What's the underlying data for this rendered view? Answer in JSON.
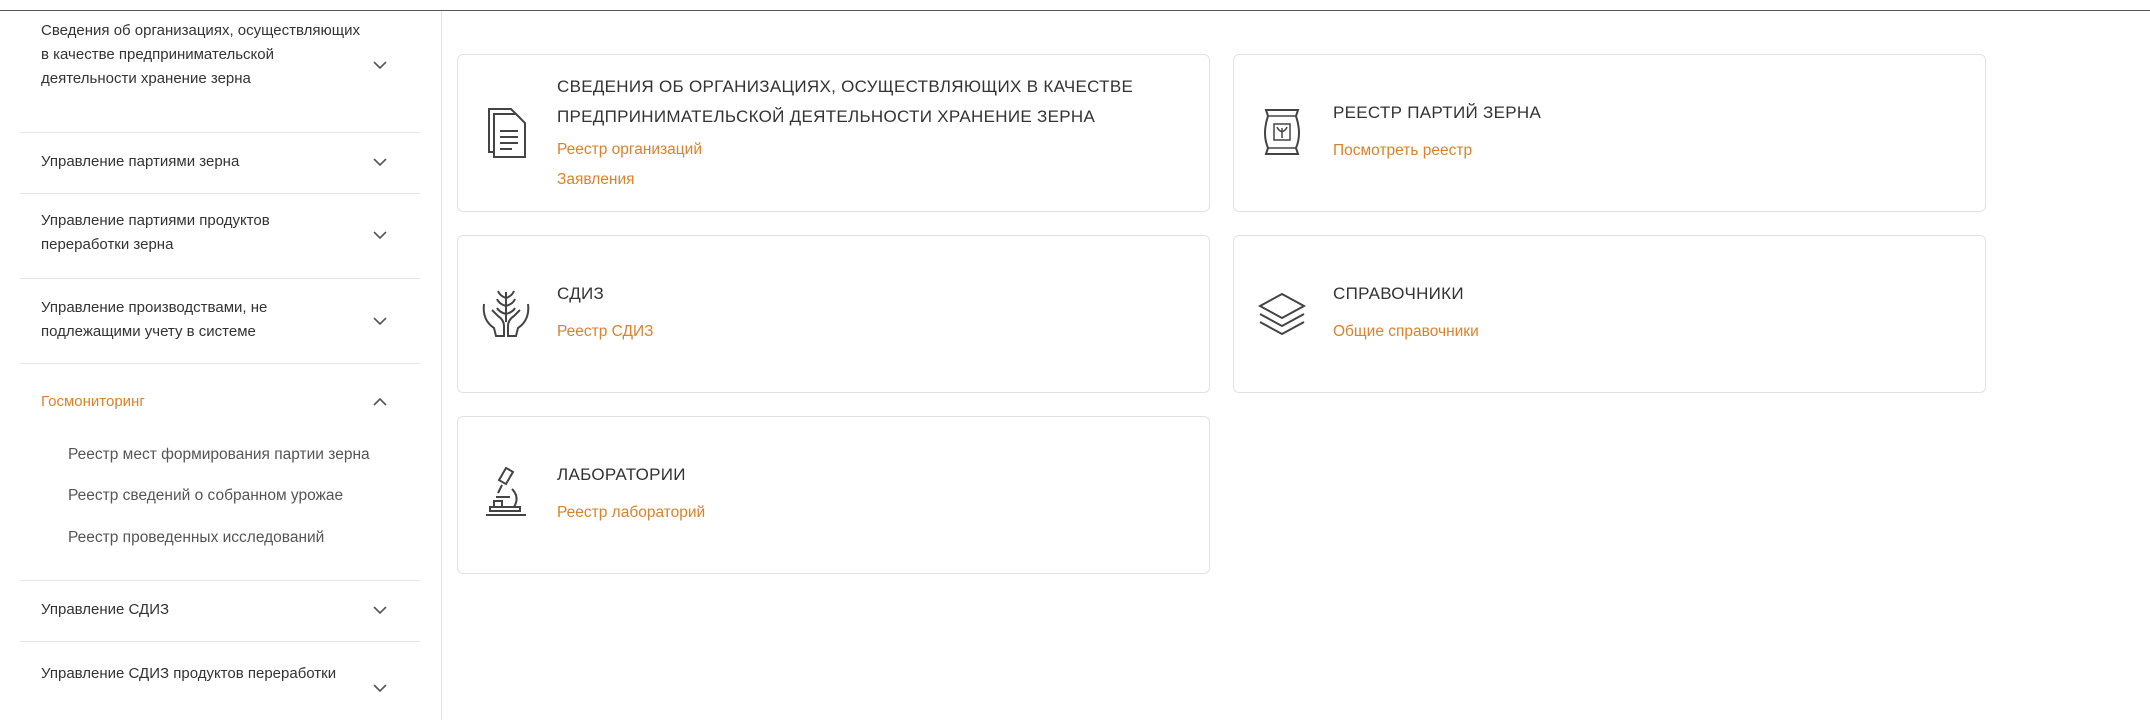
{
  "sidebar": {
    "items": [
      {
        "label": "Сведения об организациях, осуществляющих в качестве предпринимательской деятельности хранение зерна",
        "expanded": false
      },
      {
        "label": "Управление партиями зерна",
        "expanded": false
      },
      {
        "label": "Управление партиями продуктов переработки зерна",
        "expanded": false
      },
      {
        "label": "Управление производствами, не подлежащими учету в системе",
        "expanded": false
      },
      {
        "label": "Госмониторинг",
        "expanded": true,
        "children": [
          "Реестр мест формирования партии зерна",
          "Реестр сведений о собранном урожае",
          "Реестр проведенных исследований"
        ]
      },
      {
        "label": "Управление СДИЗ",
        "expanded": false
      },
      {
        "label": "Управление СДИЗ продуктов переработки",
        "expanded": false
      }
    ]
  },
  "cards": [
    {
      "icon": "documents-icon",
      "title": "СВЕДЕНИЯ ОБ ОРГАНИЗАЦИЯХ, ОСУЩЕСТВЛЯЮЩИХ В КАЧЕСТВЕ ПРЕДПРИНИМАТЕЛЬСКОЙ ДЕЯТЕЛЬНОСТИ ХРАНЕНИЕ ЗЕРНА",
      "links": [
        "Реестр организаций",
        "Заявления"
      ]
    },
    {
      "icon": "grain-bag-icon",
      "title": "РЕЕСТР ПАРТИЙ ЗЕРНА",
      "links": [
        "Посмотреть реестр"
      ]
    },
    {
      "icon": "hands-plant-icon",
      "title": "СДИЗ",
      "links": [
        "Реестр СДИЗ"
      ]
    },
    {
      "icon": "layers-icon",
      "title": "СПРАВОЧНИКИ",
      "links": [
        "Общие справочники"
      ]
    },
    {
      "icon": "microscope-icon",
      "title": "ЛАБОРАТОРИИ",
      "links": [
        "Реестр лабораторий"
      ]
    }
  ],
  "colors": {
    "accent": "#d9822b",
    "text": "#333333",
    "border": "#e2e2e2"
  }
}
